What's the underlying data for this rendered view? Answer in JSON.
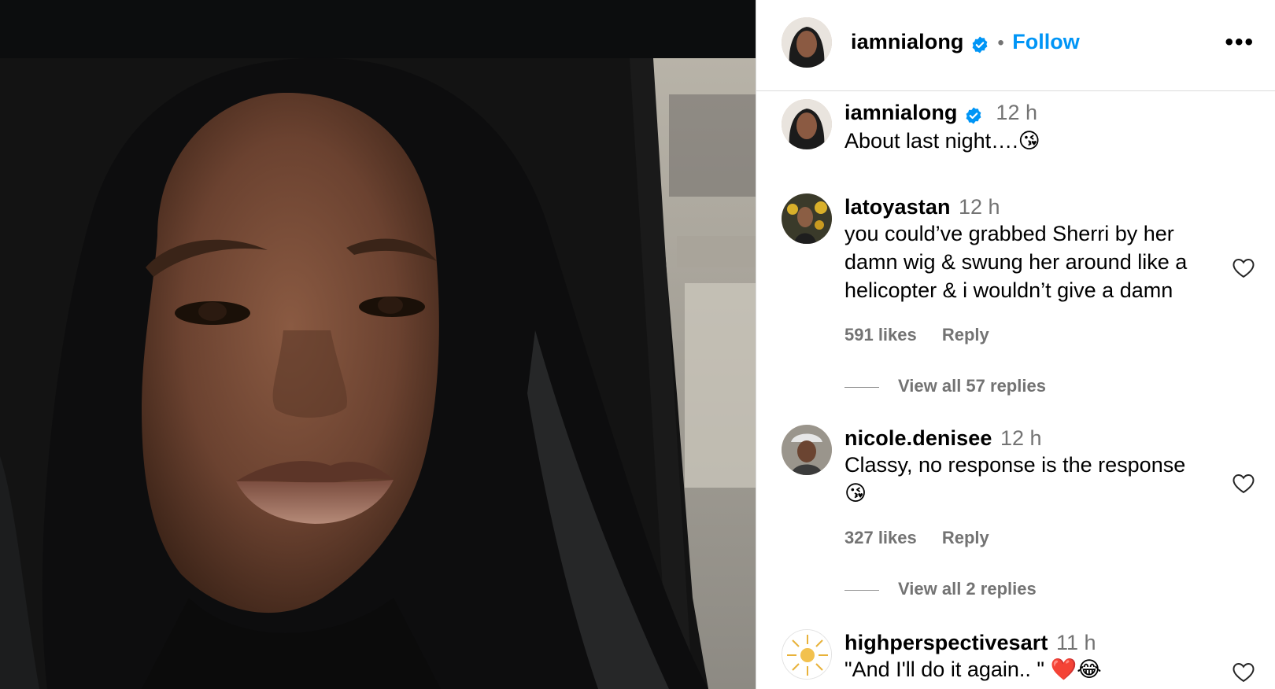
{
  "post": {
    "author": "iamnialong",
    "follow_label": "Follow",
    "separator": "•",
    "more_label": "•••",
    "caption_time": "12 h",
    "caption": "About last night….😘"
  },
  "comments": [
    {
      "username": "latoyastan",
      "time": "12 h",
      "text": "you could’ve grabbed Sherri by her damn wig & swung her around like a helicopter & i wouldn’t give a damn",
      "likes": "591 likes",
      "reply": "Reply",
      "view_replies": "View all 57 replies"
    },
    {
      "username": "nicole.denisee",
      "time": "12 h",
      "text": "Classy, no response is the response",
      "text_emoji": "😘",
      "likes": "327 likes",
      "reply": "Reply",
      "view_replies": "View all 2 replies"
    },
    {
      "username": "highperspectivesart",
      "time": "11 h",
      "text": "\"And I'll do it again.. \" ❤️😂"
    }
  ],
  "colors": {
    "accent": "#0095f6",
    "verified": "#0095f6",
    "muted": "#737373",
    "divider": "#dbdbdb"
  },
  "icons": [
    "verified-badge-icon",
    "more-options-icon",
    "heart-icon"
  ]
}
